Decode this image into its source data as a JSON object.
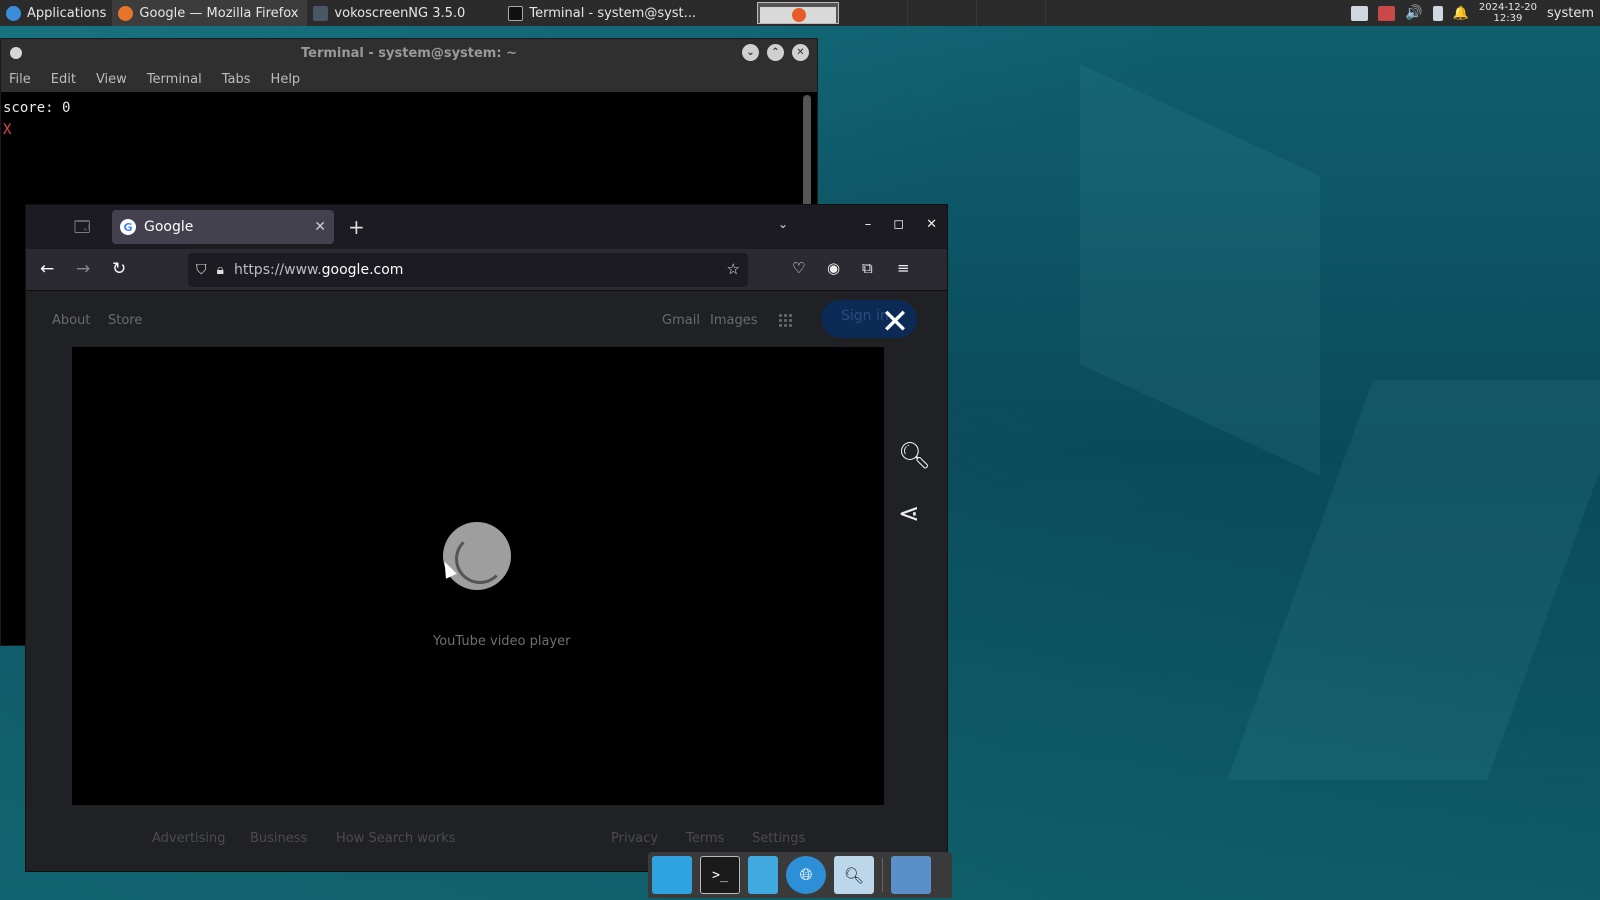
{
  "top_panel": {
    "applications_label": "Applications",
    "tasks": [
      {
        "label": "Google — Mozilla Firefox",
        "icon": "firefox-icon",
        "active": true
      },
      {
        "label": "vokoscreenNG 3.5.0",
        "icon": "vokoscreen-icon",
        "active": false
      },
      {
        "label": "Terminal - system@syst...",
        "icon": "terminal-icon",
        "active": false
      }
    ],
    "clock_date": "2024-12-20",
    "clock_time": "12:39",
    "user": "system"
  },
  "terminal": {
    "title": "Terminal - system@system: ~",
    "menu": [
      "File",
      "Edit",
      "View",
      "Terminal",
      "Tabs",
      "Help"
    ],
    "lines": [
      "score: 0",
      "X"
    ]
  },
  "firefox": {
    "tab_title": "Google",
    "url_proto": "https://www.",
    "url_host": "google.com",
    "google": {
      "top_left_links": [
        "About",
        "Store"
      ],
      "top_right_links": [
        "Gmail",
        "Images"
      ],
      "signin_label": "Sign in",
      "video_label": "YouTube video player",
      "footer_left": [
        "Advertising",
        "Business",
        "How Search works"
      ],
      "footer_right": [
        "Privacy",
        "Terms",
        "Settings"
      ]
    }
  },
  "colors": {
    "panel_bg": "#2b2b2b",
    "firefox_toolbar": "#2b2a33",
    "google_dark_bg": "#202124",
    "terminal_red": "#e04a4a"
  }
}
